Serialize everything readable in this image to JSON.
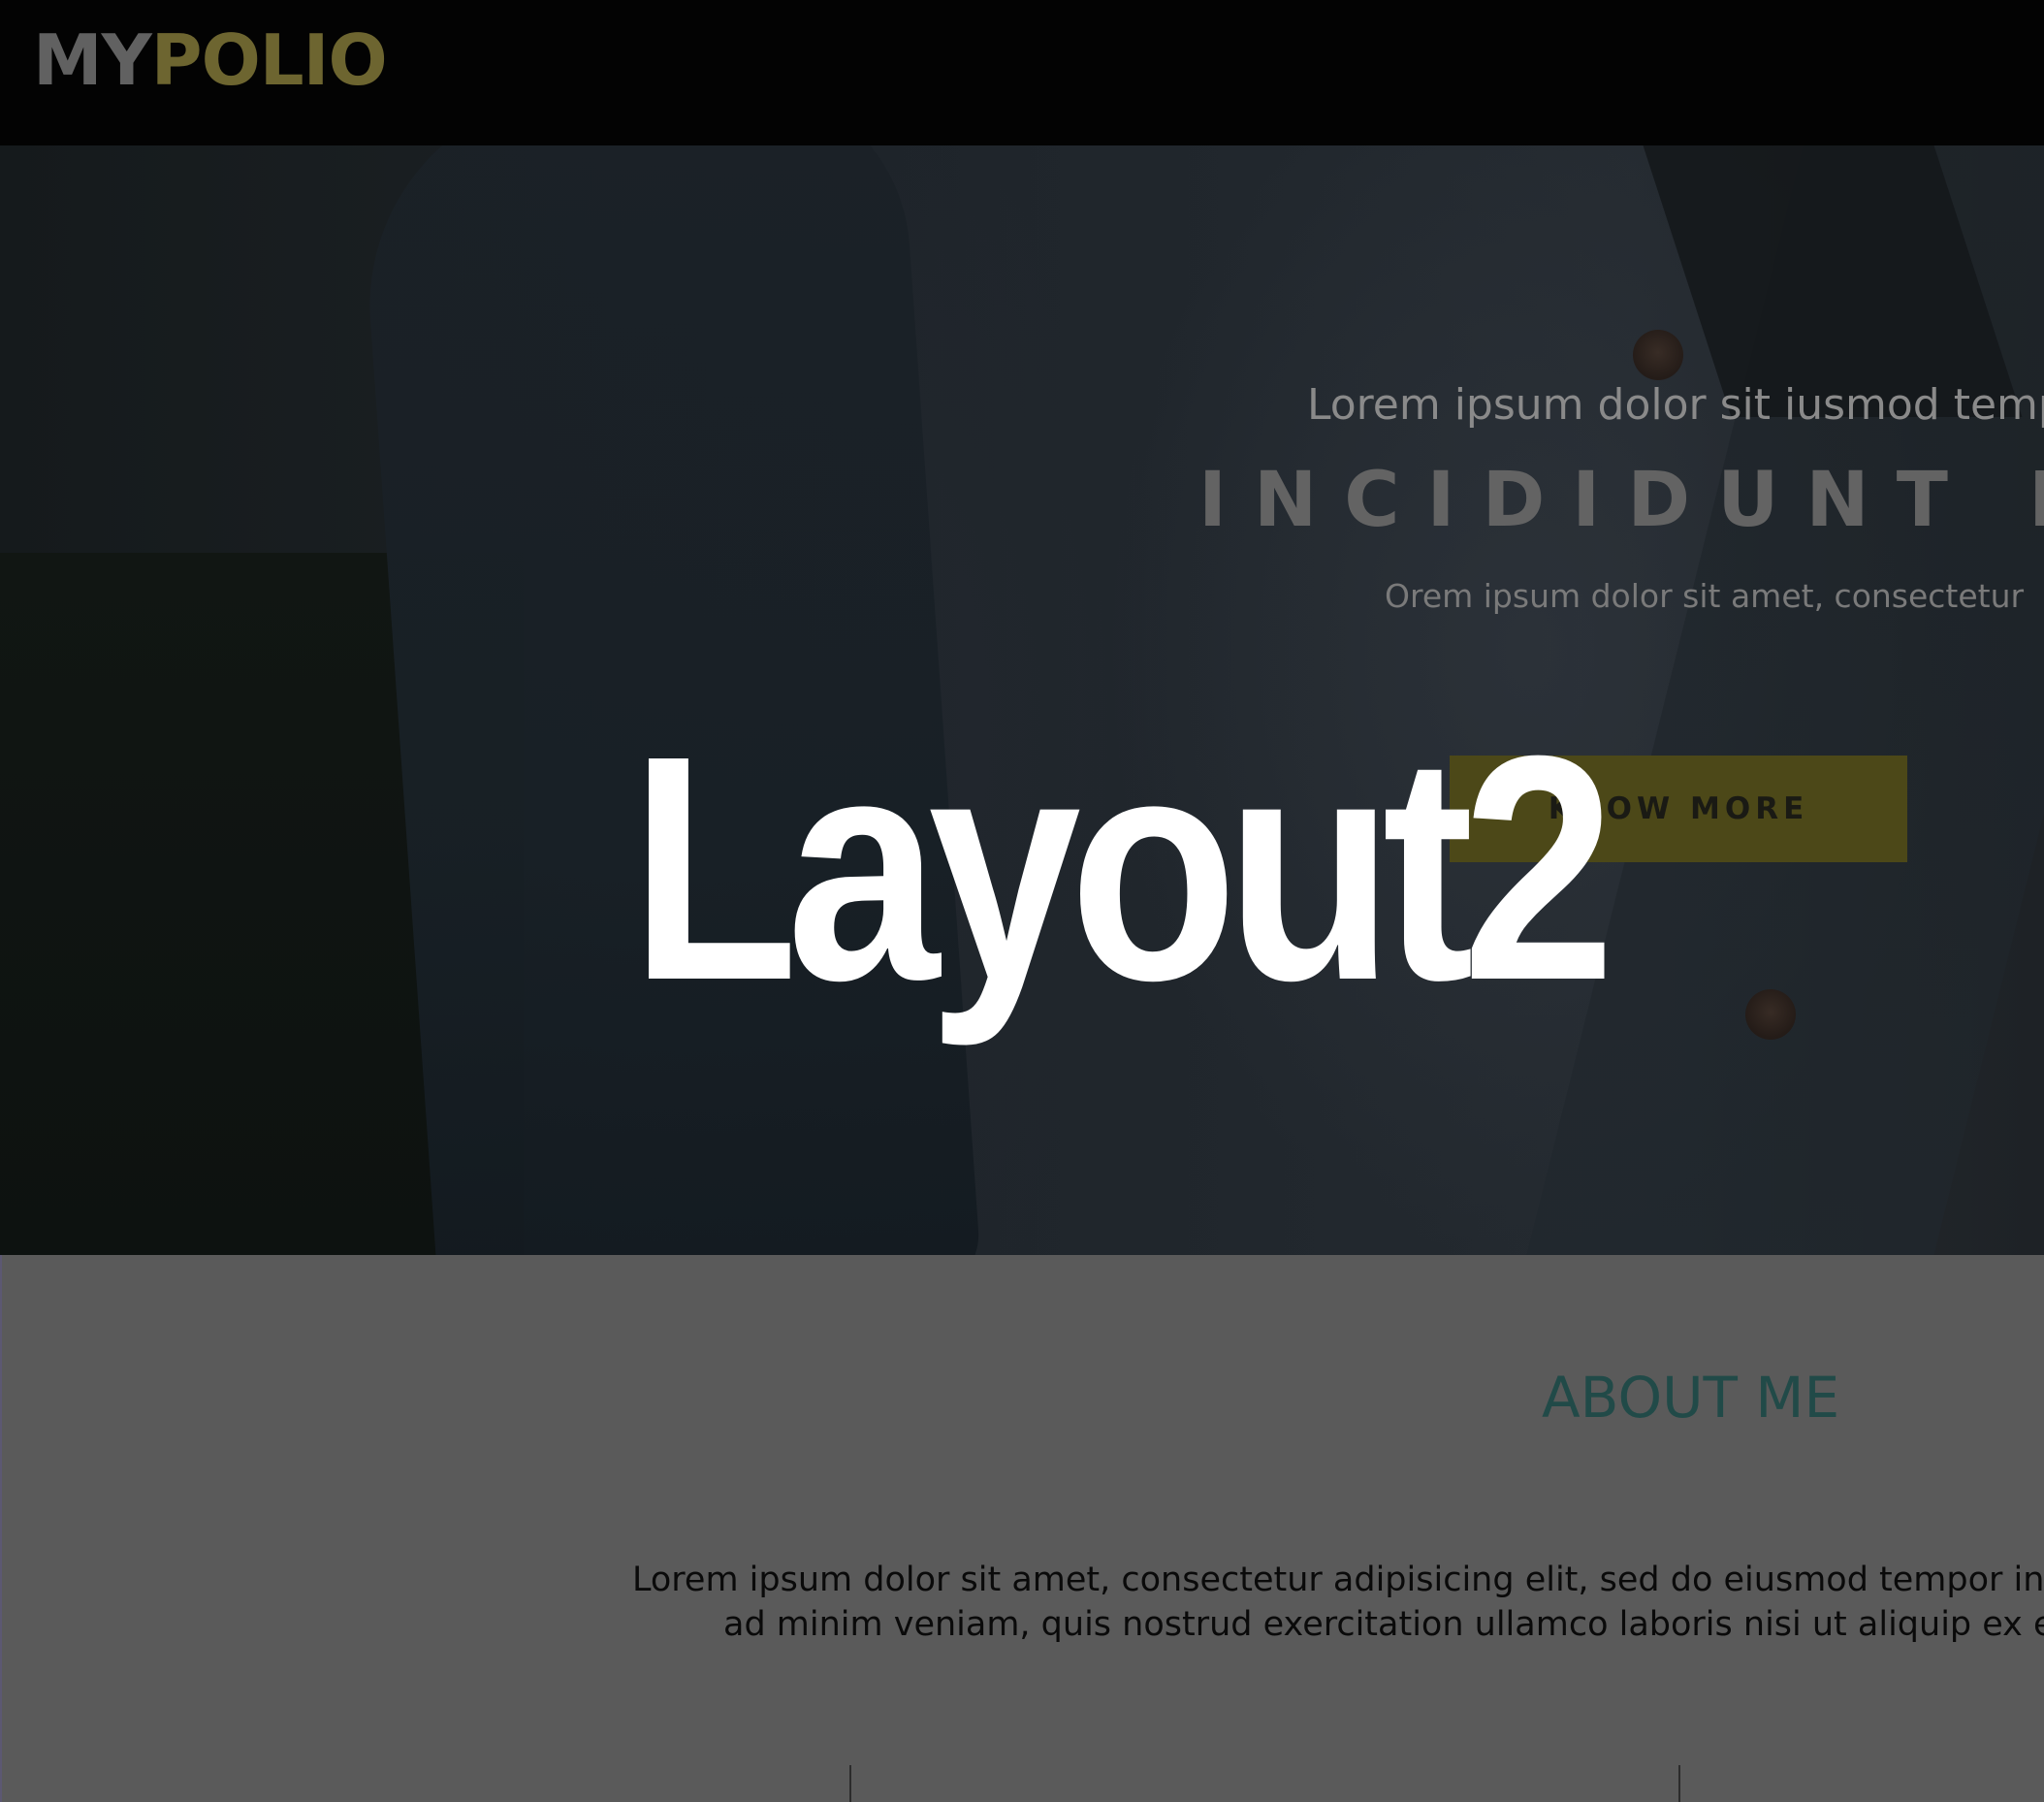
{
  "header": {
    "logo_part1": "MY",
    "logo_part2": "POLIO"
  },
  "hero": {
    "subtitle": "Lorem ipsum dolor sit iusmod tempor",
    "heading": "INCIDIDUNT BOR",
    "tagline": "Orem ipsum dolor sit amet, consectetur",
    "cta_label": "KNOW MORE"
  },
  "overlay": {
    "label": "Layout2"
  },
  "about": {
    "title": "ABOUT ME",
    "line1": "Lorem ipsum dolor sit amet, consectetur adipisicing elit, sed do eiusmod tempor incididun",
    "line2": "ad minim veniam, quis nostrud exercitation ullamco laboris nisi ut aliquip ex ea comm"
  },
  "colors": {
    "header_bg": "#030303",
    "logo_gray": "#616161",
    "logo_accent": "#6d6530",
    "cta_bg": "#4c4818",
    "about_title": "#214a48",
    "about_bg": "#5a5a5a"
  },
  "icons": [
    "none"
  ]
}
